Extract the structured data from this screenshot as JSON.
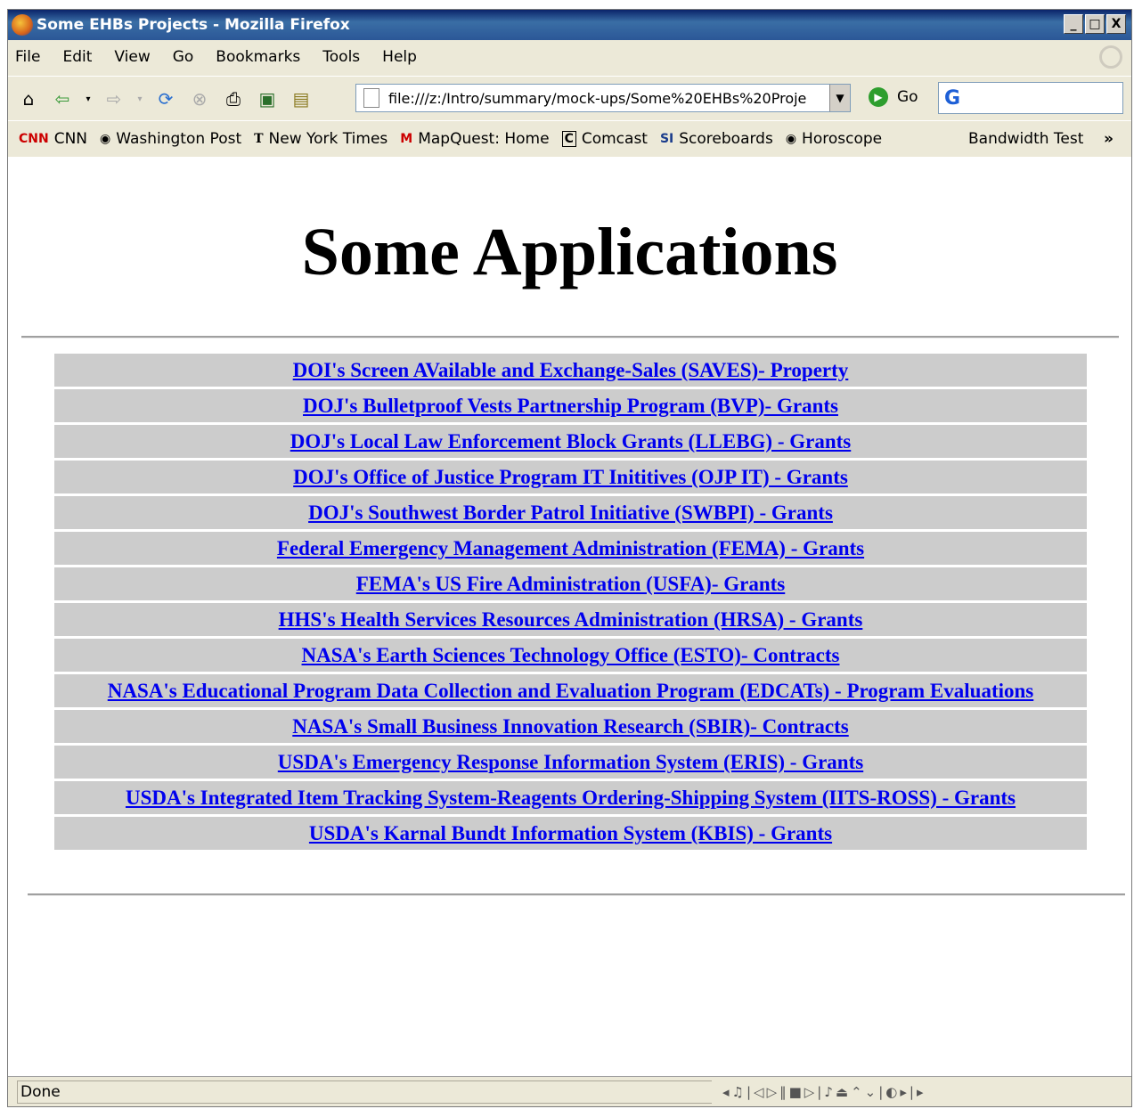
{
  "window": {
    "title": "Some EHBs Projects - Mozilla Firefox",
    "controls": [
      "_",
      "□",
      "X"
    ]
  },
  "menu": [
    "File",
    "Edit",
    "View",
    "Go",
    "Bookmarks",
    "Tools",
    "Help"
  ],
  "nav": {
    "url": "file:///z:/Intro/summary/mock-ups/Some%20EHBs%20Proje",
    "go_label": "Go",
    "search_logo": "G"
  },
  "bookmarks": [
    {
      "label": "CNN",
      "icon": "cnn-icon"
    },
    {
      "label": "Washington Post",
      "icon": "globe-icon"
    },
    {
      "label": "New York Times",
      "icon": "nyt-icon"
    },
    {
      "label": "MapQuest: Home",
      "icon": "mapquest-icon"
    },
    {
      "label": "Comcast",
      "icon": "comcast-icon"
    },
    {
      "label": "Scoreboards",
      "icon": "si-icon"
    },
    {
      "label": "Horoscope",
      "icon": "globe-icon"
    }
  ],
  "bookmark_right": "Bandwidth Test",
  "page": {
    "heading": "Some Applications",
    "links": [
      "DOI's Screen AVailable and Exchange-Sales (SAVES)- Property",
      "DOJ's Bulletproof Vests Partnership Program (BVP)- Grants",
      "DOJ's Local Law Enforcement Block Grants (LLEBG) - Grants",
      "DOJ's Office of Justice Program IT Inititives (OJP IT) - Grants",
      "DOJ's Southwest Border Patrol Initiative (SWBPI) - Grants",
      "Federal Emergency Management Administration (FEMA) - Grants",
      "FEMA's US Fire Administration (USFA)- Grants",
      "HHS's Health Services Resources Administration (HRSA) - Grants",
      "NASA's Earth Sciences Technology Office (ESTO)- Contracts",
      "NASA's Educational Program Data Collection and Evaluation Program (EDCATs) - Program Evaluations",
      "NASA's Small Business Innovation Research (SBIR)- Contracts",
      "USDA's Emergency Response Information System (ERIS) - Grants",
      "USDA's Integrated Item Tracking System-Reagents Ordering-Shipping System (IITS-ROSS) - Grants",
      "USDA's Karnal Bundt Information System (KBIS) - Grants"
    ]
  },
  "status": {
    "text": "Done"
  }
}
